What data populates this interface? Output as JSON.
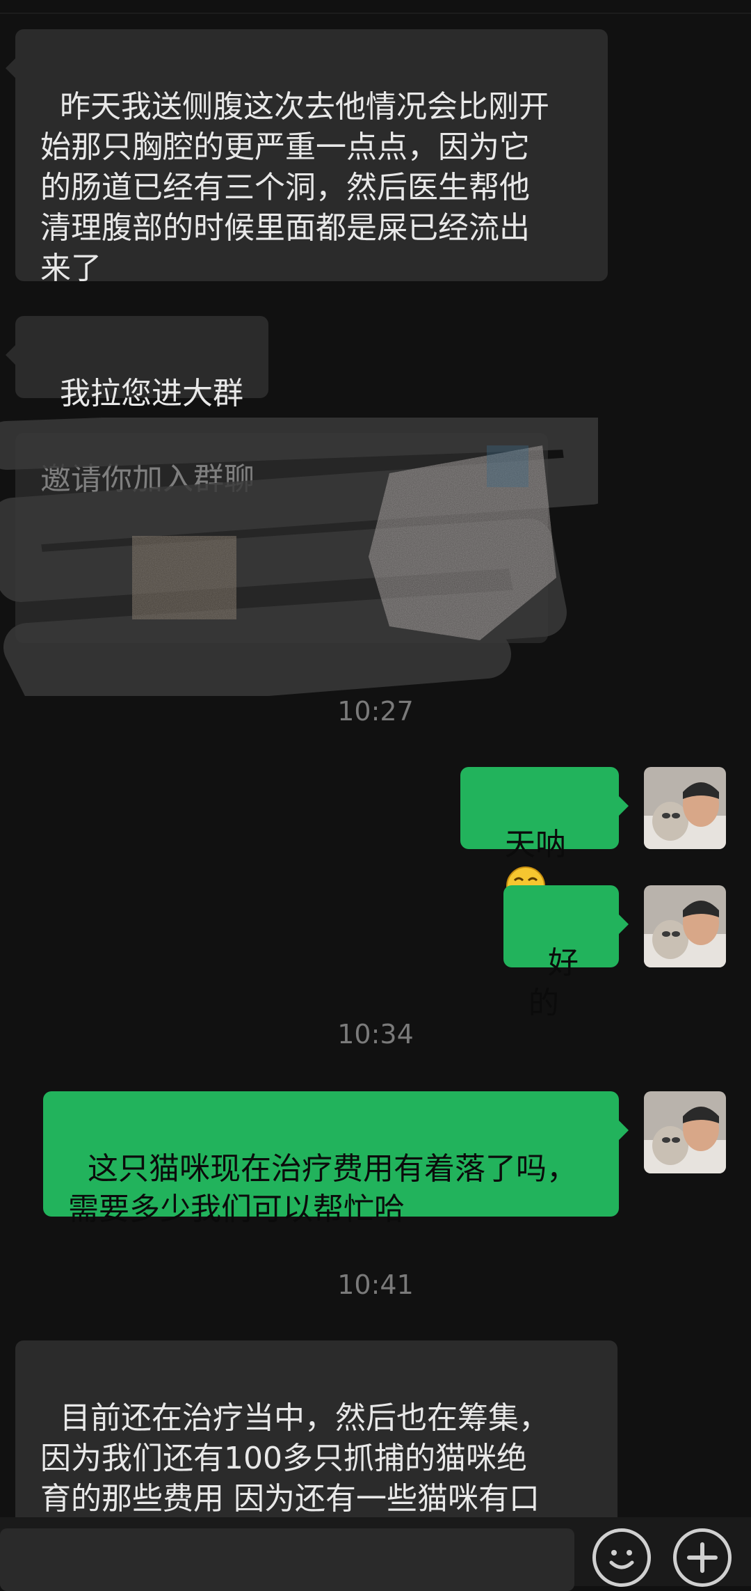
{
  "messages": {
    "msg1": "昨天我送侧腹这次去他情况会比刚开\n始那只胸腔的更严重一点点，因为它\n的肠道已经有三个洞，然后医生帮他\n清理腹部的时候里面都是屎已经流出\n来了",
    "msg2": "我拉您进大群",
    "card_title": "邀请你加入群聊",
    "msg3": "天呐",
    "msg4": "好的",
    "msg5": "这只猫咪现在治疗费用有着落了吗，\n需要多少我们可以帮忙哈",
    "msg6": "目前还在治疗当中，然后也在筹集，\n因为我们还有100多只抓捕的猫咪绝\n育的那些费用 因为还有一些猫咪有口\n咽，然后小肉热爱作，猫瘟感冒之"
  },
  "timestamps": {
    "t1": "10:27",
    "t2": "10:34",
    "t3": "10:41"
  },
  "icons": {
    "emoji": "money-mouth-emoji",
    "emoji_button": "smiley-icon",
    "more_button": "plus-icon"
  },
  "colors": {
    "background": "#111111",
    "incoming_bubble": "#2b2b2b",
    "outgoing_bubble": "#22b35c"
  }
}
